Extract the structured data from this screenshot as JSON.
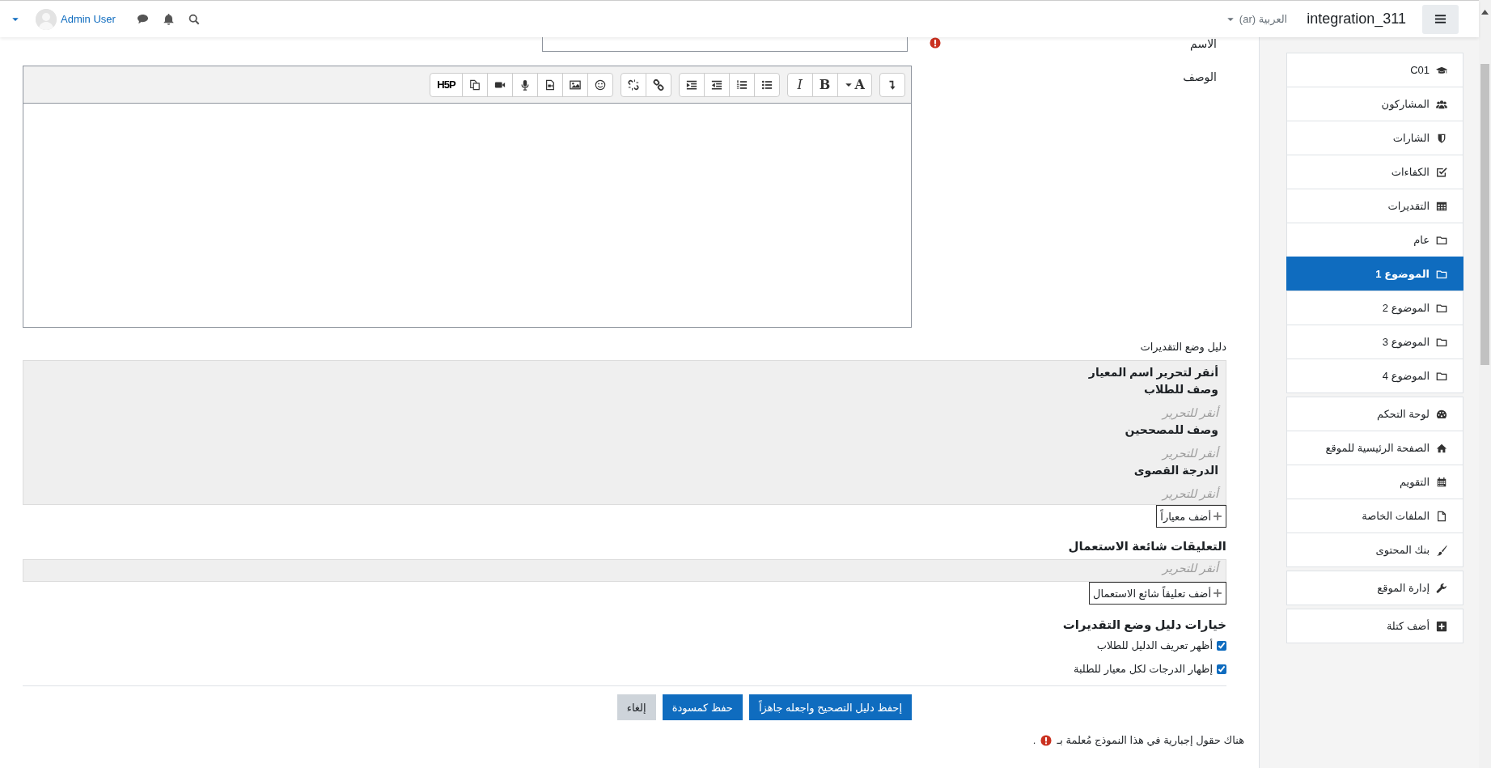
{
  "navbar": {
    "site_name": "integration_311",
    "language": "العربية (ar)",
    "user_name": "Admin User"
  },
  "name_field": {
    "label": "الاسم",
    "required": true
  },
  "description": {
    "label": "الوصف",
    "toolbar": [
      [
        {
          "kind": "collapse"
        }
      ],
      [
        {
          "kind": "font-color",
          "label": "A"
        },
        {
          "kind": "bold",
          "label": "B"
        },
        {
          "kind": "italic",
          "label": "I"
        }
      ],
      [
        {
          "kind": "bulleted-list"
        },
        {
          "kind": "numbered-list"
        },
        {
          "kind": "outdent"
        },
        {
          "kind": "indent"
        }
      ],
      [
        {
          "kind": "link"
        },
        {
          "kind": "unlink"
        }
      ],
      [
        {
          "kind": "emoji"
        },
        {
          "kind": "image"
        },
        {
          "kind": "media-file"
        },
        {
          "kind": "microphone"
        },
        {
          "kind": "video-camera"
        },
        {
          "kind": "copy"
        },
        {
          "kind": "h5p",
          "label": "H5P"
        }
      ]
    ]
  },
  "rubric": {
    "label": "دليل وضع التقديرات",
    "criterion_name": "أنقر لتحرير اسم المعيار",
    "fields": [
      {
        "heading": "وصف للطلاب",
        "text": "أنقر للتحرير"
      },
      {
        "heading": "وصف للمصححين",
        "text": "أنقر للتحرير"
      },
      {
        "heading": "الدرجة القصوى",
        "text": "أنقر للتحرير"
      }
    ],
    "add_button": "أضف معياراً"
  },
  "comments": {
    "heading": "التعليقات شائعة الاستعمال",
    "text": "أنقر للتحرير",
    "add_button": "أضف تعليقاً شائع الاستعمال"
  },
  "options": {
    "heading": "خيارات دليل وضع التقديرات",
    "checkboxes": [
      {
        "label": "أظهر تعريف الدليل للطلاب",
        "checked": true
      },
      {
        "label": "إظهار الدرجات لكل معيار للطلبة",
        "checked": true
      }
    ]
  },
  "buttons": [
    {
      "label": "إحفظ دليل التصحيح واجعله جاهزاً",
      "kind": "primary"
    },
    {
      "label": "حفظ كمسودة",
      "kind": "primary"
    },
    {
      "label": "إلغاء",
      "kind": "secondary"
    }
  ],
  "required_note": {
    "text": "هناك حقول إجبارية في هذا النموذج مُعلمة بـ",
    "end": "."
  },
  "sidebar": {
    "groups": [
      [
        {
          "label": "C01",
          "kind": "course",
          "selected": false
        },
        {
          "label": "المشاركون",
          "kind": "participants",
          "selected": false
        },
        {
          "label": "الشارات",
          "kind": "badges",
          "selected": false
        },
        {
          "label": "الكفاءات",
          "kind": "competencies",
          "selected": false
        },
        {
          "label": "التقديرات",
          "kind": "grades",
          "selected": false
        },
        {
          "label": "عام",
          "kind": "section",
          "selected": false
        },
        {
          "label": "الموضوع 1",
          "kind": "section",
          "selected": true
        },
        {
          "label": "الموضوع 2",
          "kind": "section",
          "selected": false
        },
        {
          "label": "الموضوع 3",
          "kind": "section",
          "selected": false
        },
        {
          "label": "الموضوع 4",
          "kind": "section",
          "selected": false
        }
      ],
      [
        {
          "label": "لوحة التحكم",
          "kind": "dashboard",
          "selected": false
        },
        {
          "label": "الصفحة الرئيسية للموقع",
          "kind": "home",
          "selected": false
        },
        {
          "label": "التقويم",
          "kind": "calendar",
          "selected": false
        },
        {
          "label": "الملفات الخاصة",
          "kind": "files",
          "selected": false
        },
        {
          "label": "بنك المحتوى",
          "kind": "content-bank",
          "selected": false
        }
      ],
      [
        {
          "label": "إدارة الموقع",
          "kind": "admin",
          "selected": false
        }
      ],
      [
        {
          "label": "أضف كتلة",
          "kind": "add-block",
          "selected": false
        }
      ]
    ]
  }
}
